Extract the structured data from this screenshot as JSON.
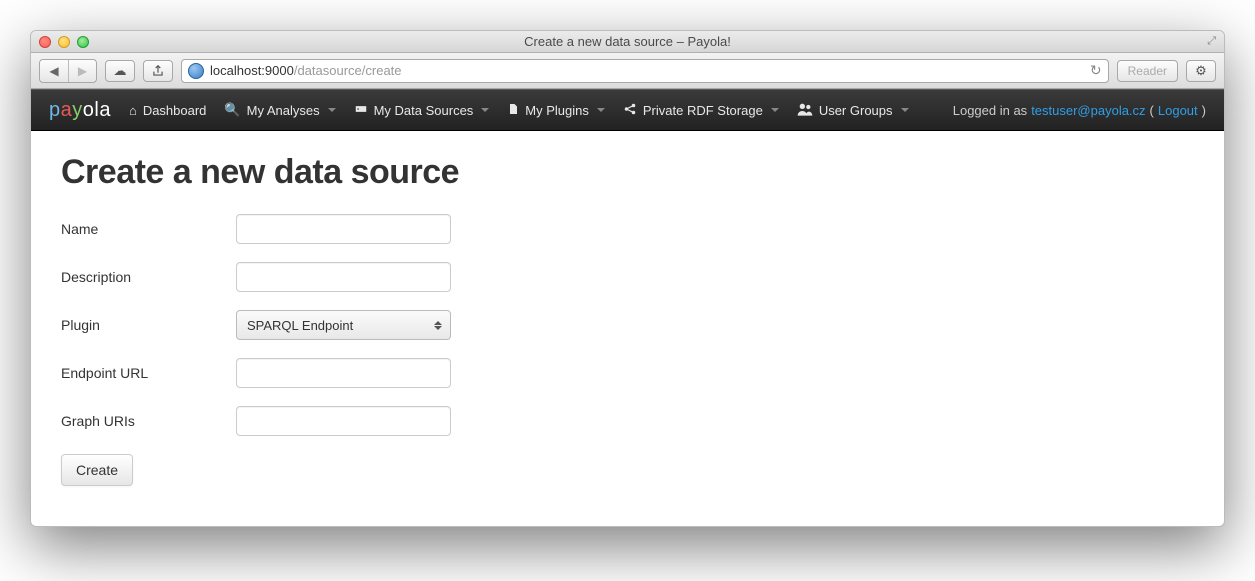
{
  "window": {
    "title": "Create a new data source – Payola!"
  },
  "browser": {
    "url_host": "localhost:9000",
    "url_path": "/datasource/create",
    "reader_label": "Reader"
  },
  "brand": {
    "seg1": "p",
    "seg2": "a",
    "seg3": "y",
    "seg4": "ola"
  },
  "nav": {
    "dashboard": "Dashboard",
    "analyses": "My Analyses",
    "datasources": "My Data Sources",
    "plugins": "My Plugins",
    "rdf": "Private RDF Storage",
    "groups": "User Groups"
  },
  "session": {
    "prefix": "Logged in as ",
    "user": "testuser@payola.cz",
    "logout": "Logout"
  },
  "page": {
    "title": "Create a new data source"
  },
  "form": {
    "name_label": "Name",
    "name_value": "",
    "description_label": "Description",
    "description_value": "",
    "plugin_label": "Plugin",
    "plugin_value": "SPARQL Endpoint",
    "endpoint_label": "Endpoint URL",
    "endpoint_value": "",
    "graphuris_label": "Graph URIs",
    "graphuris_value": "",
    "submit_label": "Create"
  }
}
